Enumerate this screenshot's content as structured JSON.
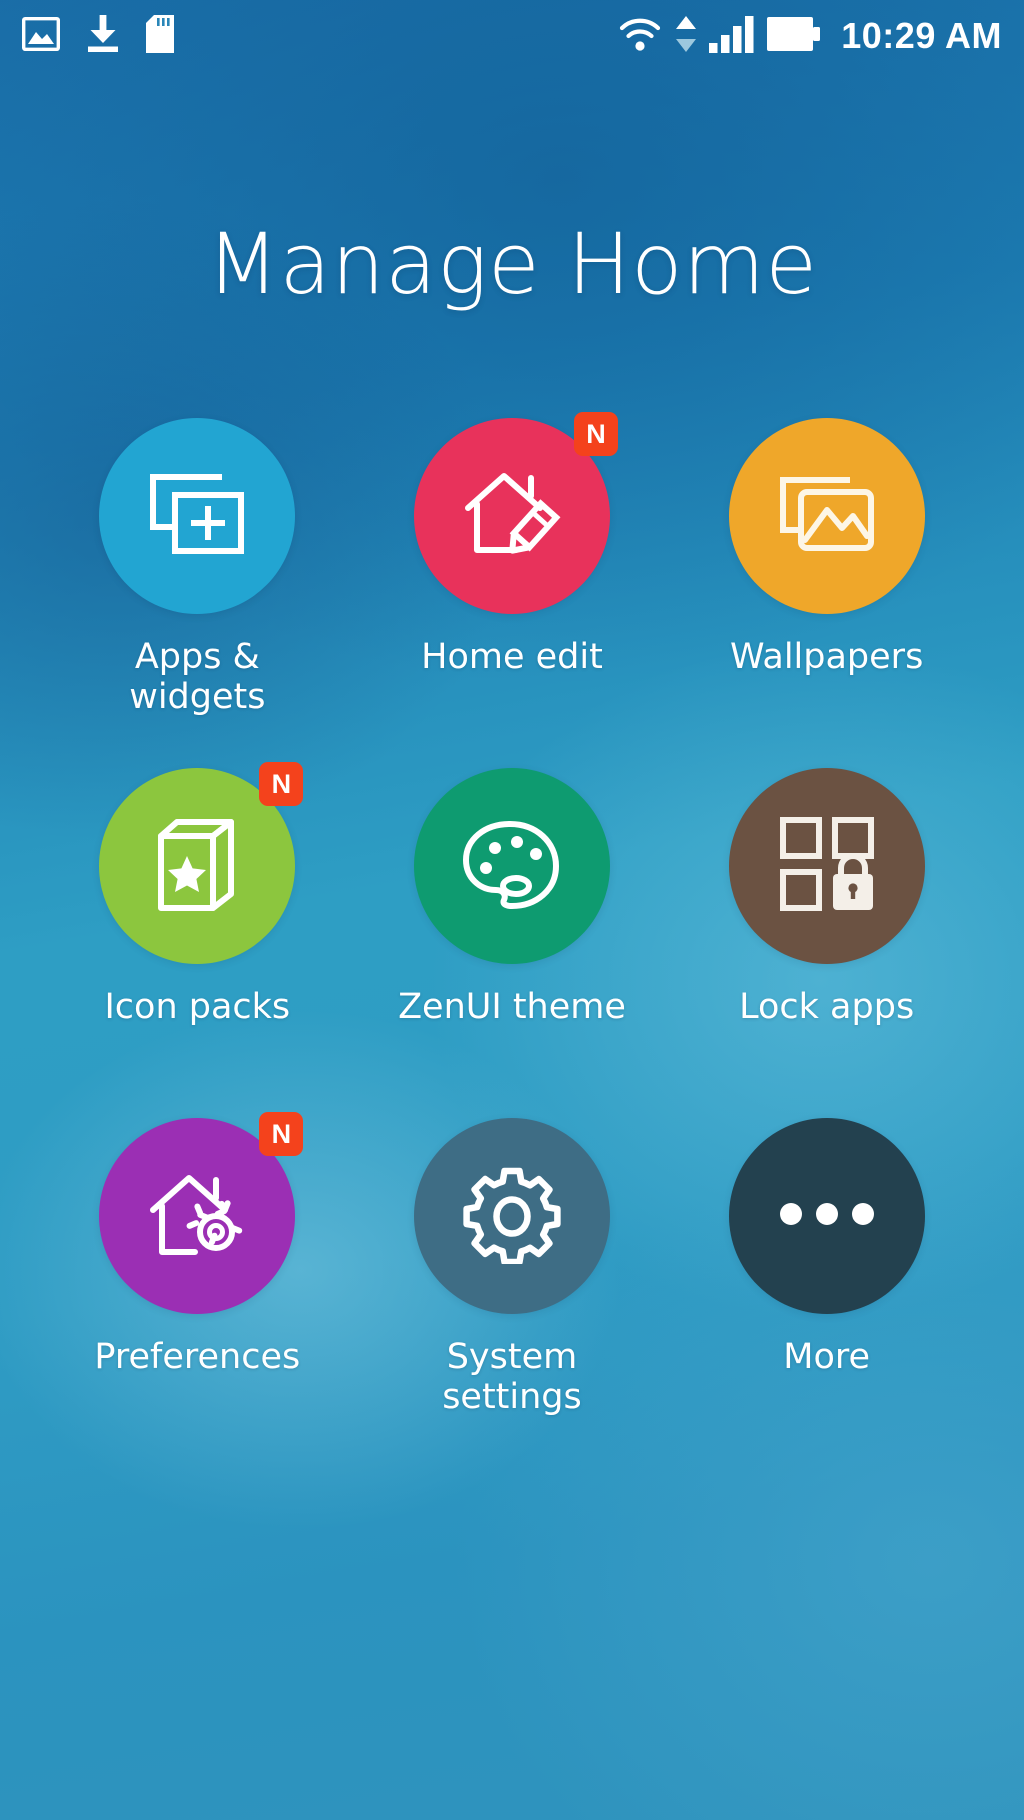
{
  "status_bar": {
    "left_icons": [
      {
        "name": "screenshot-icon",
        "label": "Screenshot"
      },
      {
        "name": "download-icon",
        "label": "Download"
      },
      {
        "name": "sd-card-icon",
        "label": "SD card"
      }
    ],
    "right_icons": [
      {
        "name": "wifi-icon",
        "label": "Wi-Fi"
      },
      {
        "name": "data-transfer-arrows-icon",
        "label": "Data transfer"
      },
      {
        "name": "cellular-signal-icon",
        "label": "Signal"
      },
      {
        "name": "battery-icon",
        "label": "Battery full"
      }
    ],
    "clock": "10:29 AM"
  },
  "header": {
    "title": "Manage Home"
  },
  "badge": {
    "new_label": "N",
    "color": "#F4421C"
  },
  "grid": {
    "items": [
      {
        "id": "apps-widgets",
        "label": "Apps & widgets",
        "icon": "apps-widgets-icon",
        "color": "#22A5D2",
        "badge": null
      },
      {
        "id": "home-edit",
        "label": "Home edit",
        "icon": "home-edit-icon",
        "color": "#E8325B",
        "badge": "N"
      },
      {
        "id": "wallpapers",
        "label": "Wallpapers",
        "icon": "wallpapers-icon",
        "color": "#EFA72A",
        "badge": null
      },
      {
        "id": "icon-packs",
        "label": "Icon packs",
        "icon": "icon-packs-icon",
        "color": "#8CC63E",
        "badge": "N"
      },
      {
        "id": "zenui-theme",
        "label": "ZenUI theme",
        "icon": "palette-icon",
        "color": "#0E9B70",
        "badge": null
      },
      {
        "id": "lock-apps",
        "label": "Lock apps",
        "icon": "lock-apps-icon",
        "color": "#6B5242",
        "badge": null
      },
      {
        "id": "preferences",
        "label": "Preferences",
        "icon": "home-settings-icon",
        "color": "#9B2FB4",
        "badge": "N"
      },
      {
        "id": "system-settings",
        "label": "System settings",
        "icon": "gear-icon",
        "color": "#3E6D85",
        "badge": null
      },
      {
        "id": "more",
        "label": "More",
        "icon": "more-dots-icon",
        "color": "#23414F",
        "badge": null
      }
    ]
  }
}
